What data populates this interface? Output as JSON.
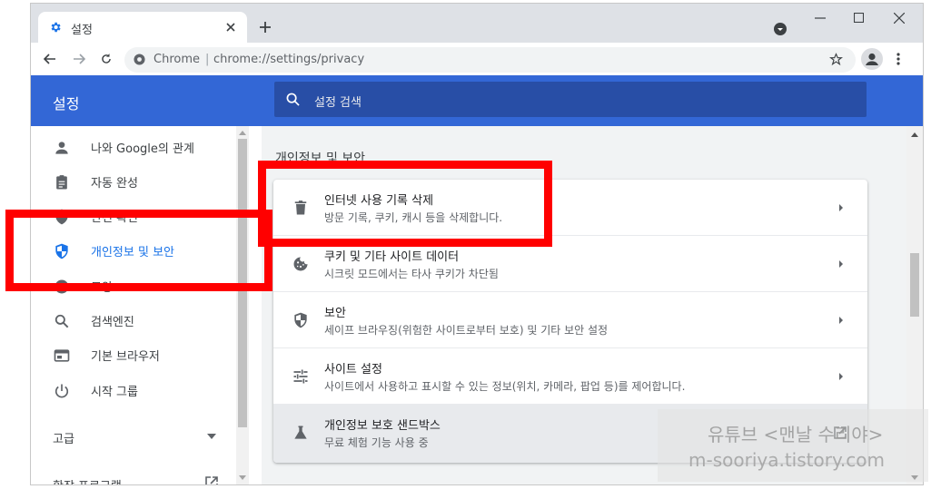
{
  "browser": {
    "tab_title": "설정",
    "address_site": "Chrome",
    "address_separator": "|",
    "address_url": "chrome://settings/privacy"
  },
  "header": {
    "title": "설정",
    "search_placeholder": "설정 검색"
  },
  "sidebar": {
    "items": [
      {
        "label": "나와 Google의 관계",
        "icon": "person-icon"
      },
      {
        "label": "자동 완성",
        "icon": "clipboard-icon"
      },
      {
        "label": "안전 확인",
        "icon": "shield-check-icon"
      },
      {
        "label": "개인정보 및 보안",
        "icon": "shield-icon"
      },
      {
        "label": "모양",
        "icon": "palette-icon"
      },
      {
        "label": "검색엔진",
        "icon": "search-icon"
      },
      {
        "label": "기본 브라우저",
        "icon": "browser-icon"
      },
      {
        "label": "시작 그룹",
        "icon": "power-icon"
      }
    ],
    "advanced_label": "고급",
    "extensions_label": "확장 프로그램"
  },
  "main": {
    "section_title": "개인정보 및 보안",
    "rows": [
      {
        "title": "인터넷 사용 기록 삭제",
        "subtitle": "방문 기록, 쿠키, 캐시 등을 삭제합니다.",
        "icon": "trash-icon"
      },
      {
        "title": "쿠키 및 기타 사이트 데이터",
        "subtitle": "시크릿 모드에서는 타사 쿠키가 차단됨",
        "icon": "cookie-icon"
      },
      {
        "title": "보안",
        "subtitle": "세이프 브라우징(위험한 사이트로부터 보호) 및 기타 보안 설정",
        "icon": "shield-icon"
      },
      {
        "title": "사이트 설정",
        "subtitle": "사이트에서 사용하고 표시할 수 있는 정보(위치, 카메라, 팝업 등)를 제어합니다.",
        "icon": "sliders-icon"
      },
      {
        "title": "개인정보 보호 샌드박스",
        "subtitle": "무료 체험 기능 사용 중",
        "icon": "flask-icon"
      }
    ]
  },
  "watermark": {
    "line1": "유튜브 <맨날 수리야>",
    "line2": "m-sooriya.tistory.com"
  },
  "colors": {
    "header_blue": "#3367d6",
    "active_blue": "#1a73e8",
    "highlight_red": "#ff0000"
  }
}
